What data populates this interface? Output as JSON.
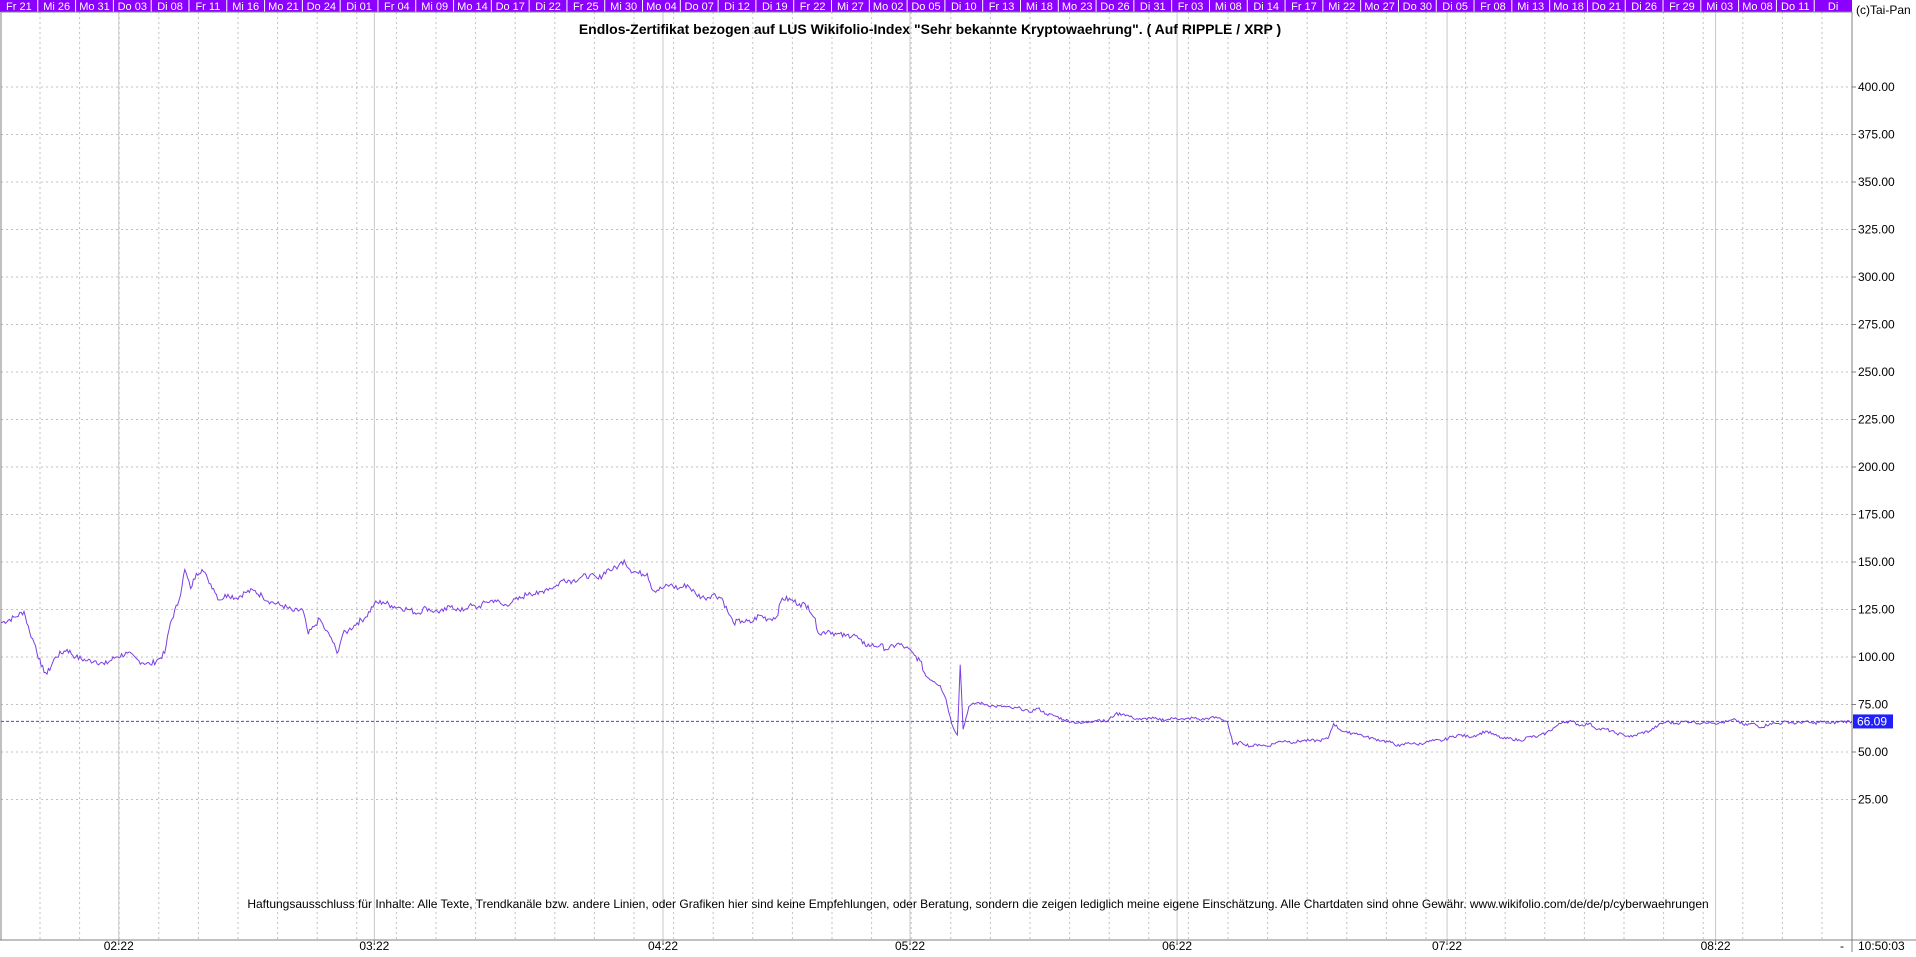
{
  "chart_data": {
    "type": "line",
    "title": "Endlos-Zertifikat bezogen auf LUS Wikifolio-Index \"Sehr bekannte Kryptowaehrung\". ( Auf RIPPLE / XRP )",
    "copyright": "(c)Tai-Pan",
    "disclaimer": "Haftungsausschluss für Inhalte: Alle Texte, Trendkanäle bzw. andere Linien, oder Grafiken hier sind keine Empfehlungen, oder Beratung, sondern die zeigen lediglich meine eigene Einschätzung. Alle Chartdaten sind ohne Gewähr.  www.wikifolio.com/de/de/p/cyberwaehrungen",
    "timestamp": "10:50:03",
    "ylim": [
      12,
      400
    ],
    "y_ticks": [
      "400.00",
      "375.00",
      "350.00",
      "325.00",
      "300.00",
      "275.00",
      "250.00",
      "225.00",
      "200.00",
      "175.00",
      "150.00",
      "125.00",
      "100.00",
      "75.00",
      "50.00",
      "25.00"
    ],
    "x_ticks": [
      {
        "label": "02:22",
        "i": 82
      },
      {
        "label": "03:22",
        "i": 260
      },
      {
        "label": "04:22",
        "i": 461
      },
      {
        "label": "05:22",
        "i": 633
      },
      {
        "label": "06:22",
        "i": 819
      },
      {
        "label": "07:22",
        "i": 1007
      },
      {
        "label": "08:22",
        "i": 1194
      }
    ],
    "x_count": 1290,
    "date_strip": [
      "Fr 21",
      "Mi 26",
      "Mo 31",
      "Do 03",
      "Di 08",
      "Fr 11",
      "Mi 16",
      "Mo 21",
      "Do 24",
      "Di 01",
      "Fr 04",
      "Mi 09",
      "Mo 14",
      "Do 17",
      "Di 22",
      "Fr 25",
      "Mi 30",
      "Mo 04",
      "Do 07",
      "Di 12",
      "Di 19",
      "Fr 22",
      "Mi 27",
      "Mo 02",
      "Do 05",
      "Di 10",
      "Fr 13",
      "Mi 18",
      "Mo 23",
      "Do 26",
      "Di 31",
      "Fr 03",
      "Mi 08",
      "Di 14",
      "Fr 17",
      "Mi 22",
      "Mo 27",
      "Do 30",
      "Di 05",
      "Fr 08",
      "Mi 13",
      "Mo 18",
      "Do 21",
      "Di 26",
      "Fr 29",
      "Mi 03",
      "Mo 08",
      "Do 11",
      "Di"
    ],
    "last_value": 66.09,
    "last_value_label": "66.09",
    "series": [
      {
        "points": [
          [
            0,
            118
          ],
          [
            10,
            121
          ],
          [
            16,
            124
          ],
          [
            20,
            113
          ],
          [
            24,
            106
          ],
          [
            28,
            95
          ],
          [
            32,
            91
          ],
          [
            38,
            100
          ],
          [
            46,
            104
          ],
          [
            52,
            100
          ],
          [
            60,
            98
          ],
          [
            66,
            98
          ],
          [
            72,
            96
          ],
          [
            80,
            100
          ],
          [
            88,
            102
          ],
          [
            96,
            98
          ],
          [
            104,
            96
          ],
          [
            110,
            99
          ],
          [
            114,
            102
          ],
          [
            118,
            118
          ],
          [
            124,
            130
          ],
          [
            128,
            146
          ],
          [
            132,
            136
          ],
          [
            136,
            144
          ],
          [
            140,
            146
          ],
          [
            144,
            141
          ],
          [
            148,
            136
          ],
          [
            152,
            130
          ],
          [
            158,
            133
          ],
          [
            164,
            131
          ],
          [
            170,
            134
          ],
          [
            176,
            135
          ],
          [
            182,
            132
          ],
          [
            188,
            129
          ],
          [
            196,
            127
          ],
          [
            204,
            124
          ],
          [
            210,
            125
          ],
          [
            214,
            112
          ],
          [
            218,
            116
          ],
          [
            222,
            120
          ],
          [
            226,
            114
          ],
          [
            230,
            110
          ],
          [
            234,
            102
          ],
          [
            238,
            112
          ],
          [
            242,
            114
          ],
          [
            248,
            118
          ],
          [
            254,
            121
          ],
          [
            260,
            128
          ],
          [
            266,
            129
          ],
          [
            272,
            127
          ],
          [
            278,
            126
          ],
          [
            284,
            125
          ],
          [
            290,
            123
          ],
          [
            296,
            126
          ],
          [
            302,
            124
          ],
          [
            308,
            124
          ],
          [
            314,
            127
          ],
          [
            320,
            124
          ],
          [
            326,
            127
          ],
          [
            332,
            126
          ],
          [
            338,
            129
          ],
          [
            344,
            130
          ],
          [
            350,
            127
          ],
          [
            356,
            129
          ],
          [
            362,
            131
          ],
          [
            368,
            134
          ],
          [
            374,
            133
          ],
          [
            380,
            136
          ],
          [
            386,
            137
          ],
          [
            392,
            141
          ],
          [
            398,
            140
          ],
          [
            404,
            142
          ],
          [
            410,
            143
          ],
          [
            416,
            141
          ],
          [
            422,
            146
          ],
          [
            426,
            146
          ],
          [
            430,
            148
          ],
          [
            434,
            151
          ],
          [
            438,
            146
          ],
          [
            444,
            144
          ],
          [
            450,
            144
          ],
          [
            454,
            135
          ],
          [
            460,
            136
          ],
          [
            466,
            138
          ],
          [
            472,
            136
          ],
          [
            478,
            138
          ],
          [
            484,
            133
          ],
          [
            490,
            131
          ],
          [
            496,
            133
          ],
          [
            502,
            131
          ],
          [
            506,
            124
          ],
          [
            510,
            118
          ],
          [
            516,
            119
          ],
          [
            522,
            118
          ],
          [
            528,
            122
          ],
          [
            534,
            120
          ],
          [
            540,
            121
          ],
          [
            544,
            131
          ],
          [
            550,
            130
          ],
          [
            556,
            128
          ],
          [
            562,
            127
          ],
          [
            566,
            121
          ],
          [
            570,
            112
          ],
          [
            576,
            114
          ],
          [
            582,
            112
          ],
          [
            588,
            111
          ],
          [
            594,
            112
          ],
          [
            600,
            107
          ],
          [
            606,
            106
          ],
          [
            612,
            106
          ],
          [
            618,
            104
          ],
          [
            624,
            107
          ],
          [
            630,
            105
          ],
          [
            636,
            101
          ],
          [
            640,
            98
          ],
          [
            644,
            90
          ],
          [
            650,
            87
          ],
          [
            654,
            85
          ],
          [
            658,
            78
          ],
          [
            662,
            65
          ],
          [
            666,
            59
          ],
          [
            668,
            96
          ],
          [
            670,
            62
          ],
          [
            674,
            74
          ],
          [
            680,
            76
          ],
          [
            686,
            75
          ],
          [
            692,
            74
          ],
          [
            698,
            74
          ],
          [
            704,
            73
          ],
          [
            710,
            73
          ],
          [
            716,
            71
          ],
          [
            722,
            73
          ],
          [
            728,
            70
          ],
          [
            734,
            69
          ],
          [
            740,
            67
          ],
          [
            746,
            66
          ],
          [
            752,
            65
          ],
          [
            758,
            66
          ],
          [
            764,
            67
          ],
          [
            770,
            66
          ],
          [
            776,
            70
          ],
          [
            782,
            70
          ],
          [
            788,
            68
          ],
          [
            794,
            67
          ],
          [
            800,
            68
          ],
          [
            806,
            67
          ],
          [
            812,
            67
          ],
          [
            818,
            68
          ],
          [
            824,
            67
          ],
          [
            830,
            68
          ],
          [
            836,
            67
          ],
          [
            842,
            68
          ],
          [
            848,
            68
          ],
          [
            854,
            66
          ],
          [
            858,
            54
          ],
          [
            864,
            55
          ],
          [
            870,
            53
          ],
          [
            876,
            54
          ],
          [
            882,
            53
          ],
          [
            888,
            55
          ],
          [
            894,
            56
          ],
          [
            900,
            55
          ],
          [
            906,
            56
          ],
          [
            912,
            56
          ],
          [
            918,
            56
          ],
          [
            924,
            57
          ],
          [
            928,
            65
          ],
          [
            932,
            62
          ],
          [
            938,
            60
          ],
          [
            944,
            60
          ],
          [
            950,
            58
          ],
          [
            956,
            57
          ],
          [
            962,
            56
          ],
          [
            968,
            55
          ],
          [
            974,
            53
          ],
          [
            980,
            55
          ],
          [
            986,
            54
          ],
          [
            992,
            55
          ],
          [
            998,
            56
          ],
          [
            1004,
            56
          ],
          [
            1010,
            58
          ],
          [
            1016,
            59
          ],
          [
            1022,
            58
          ],
          [
            1028,
            59
          ],
          [
            1034,
            61
          ],
          [
            1040,
            59
          ],
          [
            1046,
            57
          ],
          [
            1052,
            57
          ],
          [
            1058,
            56
          ],
          [
            1064,
            58
          ],
          [
            1070,
            58
          ],
          [
            1076,
            60
          ],
          [
            1082,
            63
          ],
          [
            1088,
            66
          ],
          [
            1094,
            66
          ],
          [
            1100,
            64
          ],
          [
            1106,
            65
          ],
          [
            1112,
            62
          ],
          [
            1118,
            62
          ],
          [
            1124,
            60
          ],
          [
            1130,
            59
          ],
          [
            1136,
            58
          ],
          [
            1142,
            60
          ],
          [
            1148,
            61
          ],
          [
            1154,
            64
          ],
          [
            1160,
            66
          ],
          [
            1166,
            65
          ],
          [
            1172,
            66
          ],
          [
            1178,
            66
          ],
          [
            1184,
            65
          ],
          [
            1190,
            66
          ],
          [
            1196,
            65
          ],
          [
            1202,
            66
          ],
          [
            1208,
            67
          ],
          [
            1214,
            64
          ],
          [
            1220,
            65
          ],
          [
            1226,
            63
          ],
          [
            1232,
            65
          ],
          [
            1238,
            65
          ],
          [
            1244,
            66
          ],
          [
            1250,
            65
          ],
          [
            1256,
            66
          ],
          [
            1262,
            65
          ],
          [
            1268,
            66
          ],
          [
            1274,
            65
          ],
          [
            1280,
            66
          ],
          [
            1289,
            66.09
          ]
        ]
      }
    ],
    "colors": {
      "line": "#7b3fe4",
      "last_value_line": "#4040ff",
      "date_strip_bg": "#8b00ff",
      "grid": "#c0c0c0"
    }
  }
}
